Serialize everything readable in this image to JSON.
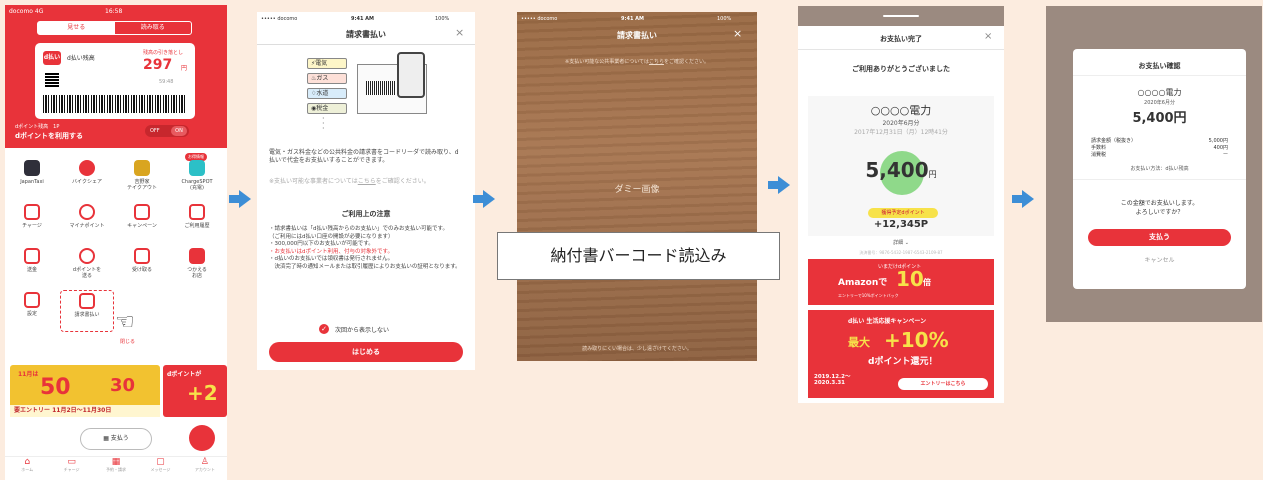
{
  "screen1": {
    "status_carrier": "docomo 4G",
    "status_time": "16:58",
    "seg_show": "見せる",
    "seg_read": "読み取る",
    "card_brand": "d払い残高",
    "balance_label": "残高の引き落とし",
    "balance_value": "297",
    "balance_unit": "円",
    "timer": "59:48",
    "dpoint_balance": "dポイント残高　1P",
    "use_dpoint": "dポイントを利用する",
    "toggle_off": "OFF",
    "toggle_on": "ON",
    "campaign_tag": "お得情報",
    "grid": [
      {
        "label": "JapanTaxi",
        "color": "#2f2f3a"
      },
      {
        "label": "バイクシェア",
        "color": "#e8333a"
      },
      {
        "label": "吉野家\nテイクアウト",
        "color": "#d9a520"
      },
      {
        "label": "ChargeSPOT\n(充電)",
        "color": "#2cc0c7"
      },
      {
        "label": "チャージ",
        "color": "#e8333a"
      },
      {
        "label": "マイナポイント",
        "color": "#e8333a"
      },
      {
        "label": "キャンペーン",
        "color": "#e8333a"
      },
      {
        "label": "ご利用履歴",
        "color": "#e8333a"
      },
      {
        "label": "送金",
        "color": "#e8333a"
      },
      {
        "label": "dポイントを\n送る",
        "color": "#e8333a"
      },
      {
        "label": "受け取る",
        "color": "#e8333a"
      },
      {
        "label": "つかえる\nお店",
        "color": "#e8333a"
      },
      {
        "label": "設定",
        "color": "#e8333a"
      },
      {
        "label": "請求書払い",
        "color": "#e8333a"
      }
    ],
    "close_link": "閉じる",
    "banner_month": "11月は",
    "banner_big": "50",
    "banner_mid": "30",
    "banner_entry": "要エントリー 11月2日",
    "banner_entry_end": "〜11月30日",
    "banner_right_text": "dポイントが",
    "banner_right_big": "+2",
    "pay_button": "支払う",
    "tabs": [
      "ホーム",
      "チャージ",
      "予約・請求",
      "メッセージ",
      "アカウント"
    ]
  },
  "screen2": {
    "status_carrier": "••••• docomo",
    "status_time": "9:41 AM",
    "status_battery": "100%",
    "title": "請求書払い",
    "tags": [
      "電気",
      "ガス",
      "水道",
      "税金"
    ],
    "desc": "電気・ガス料金などの公共料金の請求書をコードリーダで読み取り、d払いで代金をお支払いすることができます。",
    "note_prefix": "※支払い可能な事業者については",
    "note_link": "こちら",
    "note_suffix": "をご確認ください。",
    "notice_title": "ご利用上の注意",
    "notice_lines": [
      "・請求書払いは「d払い残高からのお支払い」でのみお支払い可能です。",
      "（ご利用にはd払い口座の開設が必要になります）",
      "・300,000円以下のお支払いが可能です。",
      "・お支払いはdポイント利用、付与の対象外です。",
      "・d払いのお支払いでは領収書は発行されません。",
      "　決済完了時の通知メールまたは取引履歴によりお支払いの証明となります。"
    ],
    "checkbox_label": "次回から表示しない",
    "start_button": "はじめる"
  },
  "screen3": {
    "status_carrier": "••••• docomo",
    "status_time": "9:41 AM",
    "status_battery": "100%",
    "title": "請求書払い",
    "note_prefix": "※支払い可能な公共事業者については",
    "note_link": "こちら",
    "note_suffix": "をご確認ください。",
    "dummy": "ダミー画像",
    "hint": "読み取りにくい場合は、少し遠ざけてください。",
    "callout": "納付書バーコード読込み"
  },
  "screen4": {
    "title": "お支払い完了",
    "thanks": "ご利用ありがとうございました",
    "payee": "○○○○電力",
    "period": "2020年6月分",
    "datetime": "2017年12月31日（月）12時41分",
    "amount": "5,400",
    "amount_unit": "円",
    "points_label": "獲得予定dポイント",
    "points": "+12,345P",
    "detail": "詳細",
    "txn": "決済番号：9876-5432-1987-6543-2109-87",
    "promo1_line1": "いまだけdポイント",
    "promo1_brand": "Amazonで",
    "promo1_big": "10",
    "promo1_unit": "倍",
    "promo1_sub": "エントリーで10%ポイントバック",
    "promo2_title": "d払い 生活応援キャンペーン",
    "promo2_big_prefix": "最大",
    "promo2_big": "+10%",
    "promo2_sub": "dポイント還元！",
    "promo2_dates": "2019.12.2〜\n2020.3.31",
    "promo2_button": "エントリーはこちら"
  },
  "screen5": {
    "title": "お支払い確認",
    "payee": "○○○○電力",
    "period": "2020年6月分",
    "amount": "5,400円",
    "rows": [
      {
        "label": "請求金額（税抜き）",
        "value": "5,000円"
      },
      {
        "label": "手数料",
        "value": "400円"
      },
      {
        "label": "消費税",
        "value": "ー"
      }
    ],
    "method": "お支払い方法：d払い残高",
    "confirm": "この金額でお支払いします。\nよろしいですか？",
    "pay_button": "支払う",
    "cancel": "キャンセル"
  }
}
